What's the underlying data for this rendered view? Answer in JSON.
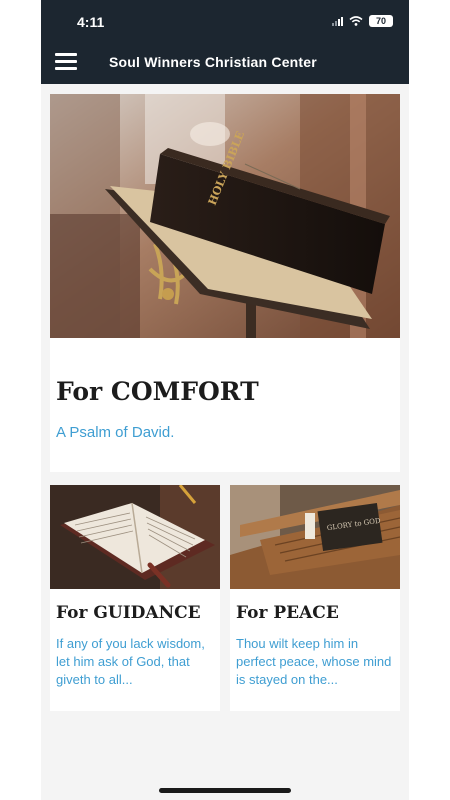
{
  "status_bar": {
    "time": "4:11",
    "battery": "70"
  },
  "header": {
    "title": "Soul Winners Christian Center"
  },
  "featured": {
    "title": "For COMFORT",
    "subtitle": "A Psalm of David.",
    "image_text": {
      "book_spine": "HOLY BIBLE"
    }
  },
  "cards": [
    {
      "title": "For GUIDANCE",
      "excerpt": "If any of you lack wisdom, let him ask of God, that giveth to all..."
    },
    {
      "title": "For PEACE",
      "excerpt": "Thou wilt keep him in perfect peace, whose mind is stayed on the...",
      "image_text": "GLORY to GOD"
    }
  ],
  "colors": {
    "header": "#1c2630",
    "accent_text": "#3f9ed2",
    "page_background": "#f4f4f4"
  },
  "icons": [
    "hamburger-menu-icon",
    "cellular-signal-icon",
    "wifi-icon",
    "battery-icon"
  ]
}
